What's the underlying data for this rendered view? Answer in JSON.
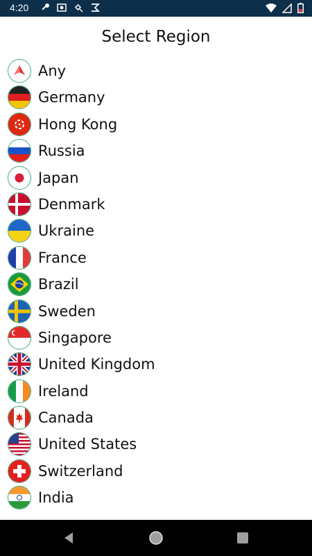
{
  "status_bar": {
    "time": "4:20",
    "left_icons": [
      "key-icon",
      "photo-icon",
      "satellite-icon",
      "vpn-icon"
    ],
    "right_icons": [
      "wifi-icon",
      "signal-icon",
      "battery-low-icon"
    ]
  },
  "page": {
    "title": "Select Region"
  },
  "regions": [
    {
      "name": "Any",
      "flag": "any-icon"
    },
    {
      "name": "Germany",
      "flag": "germany-flag-icon"
    },
    {
      "name": "Hong Kong",
      "flag": "hong-kong-flag-icon"
    },
    {
      "name": "Russia",
      "flag": "russia-flag-icon"
    },
    {
      "name": "Japan",
      "flag": "japan-flag-icon"
    },
    {
      "name": "Denmark",
      "flag": "denmark-flag-icon"
    },
    {
      "name": "Ukraine",
      "flag": "ukraine-flag-icon"
    },
    {
      "name": "France",
      "flag": "france-flag-icon"
    },
    {
      "name": "Brazil",
      "flag": "brazil-flag-icon"
    },
    {
      "name": "Sweden",
      "flag": "sweden-flag-icon"
    },
    {
      "name": "Singapore",
      "flag": "singapore-flag-icon"
    },
    {
      "name": "United Kingdom",
      "flag": "united-kingdom-flag-icon"
    },
    {
      "name": "Ireland",
      "flag": "ireland-flag-icon"
    },
    {
      "name": "Canada",
      "flag": "canada-flag-icon"
    },
    {
      "name": "United States",
      "flag": "united-states-flag-icon"
    },
    {
      "name": "Switzerland",
      "flag": "switzerland-flag-icon"
    },
    {
      "name": "India",
      "flag": "india-flag-icon"
    },
    {
      "name": "",
      "flag": "partial-flag-icon"
    }
  ],
  "nav_bar": {
    "buttons": [
      "back-icon",
      "home-icon",
      "recents-icon"
    ]
  },
  "colors": {
    "status_bar_bg": "#0d2f4a",
    "flag_ring": "#3fa37d",
    "nav_bar_bg": "#000000",
    "text": "#111111"
  }
}
